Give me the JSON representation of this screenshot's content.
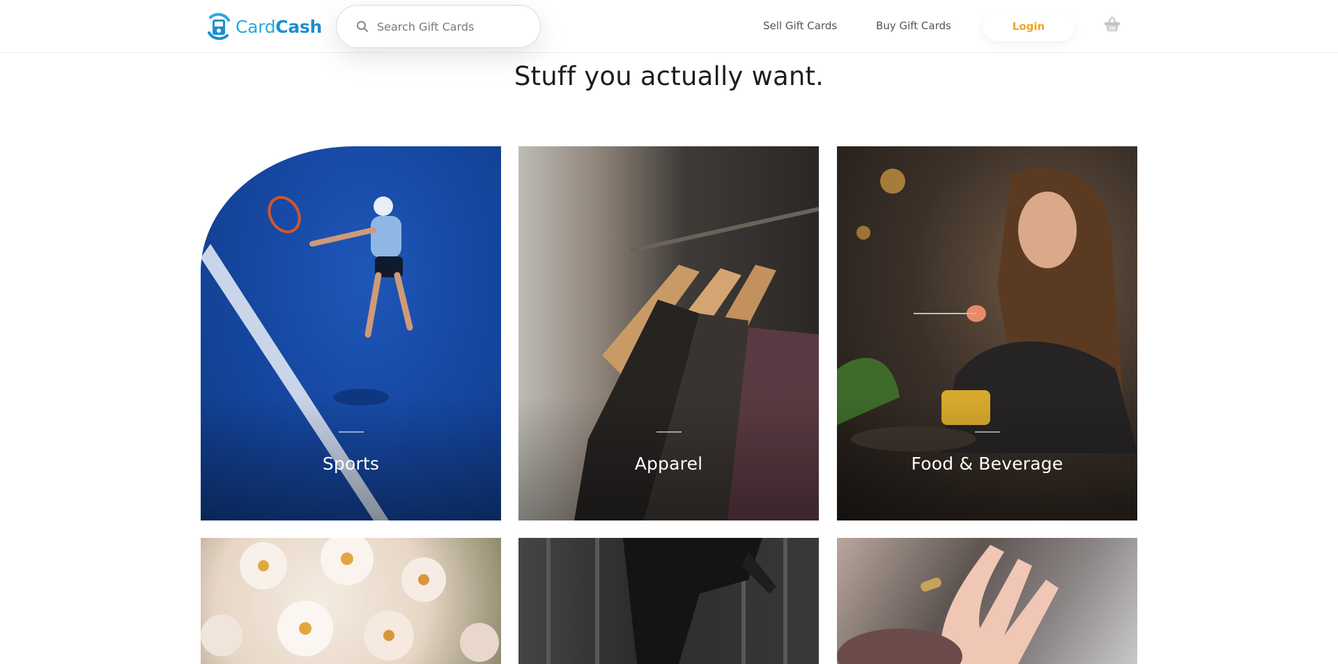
{
  "header": {
    "logo": {
      "word_light": "Card",
      "word_bold": "Cash"
    },
    "search": {
      "placeholder": "Search Gift Cards",
      "icon": "search-icon"
    },
    "nav": {
      "sell": "Sell Gift Cards",
      "buy": "Buy Gift Cards",
      "login": "Login"
    },
    "cart_icon": "basket-icon"
  },
  "headline": "Stuff you actually want.",
  "categories": [
    {
      "label": "Sports"
    },
    {
      "label": "Apparel"
    },
    {
      "label": "Food & Beverage"
    }
  ],
  "colors": {
    "brand_blue": "#29a8e0",
    "brand_blue_dark": "#1b8fd1",
    "login_orange": "#f5a21b",
    "nav_text": "#555555"
  }
}
